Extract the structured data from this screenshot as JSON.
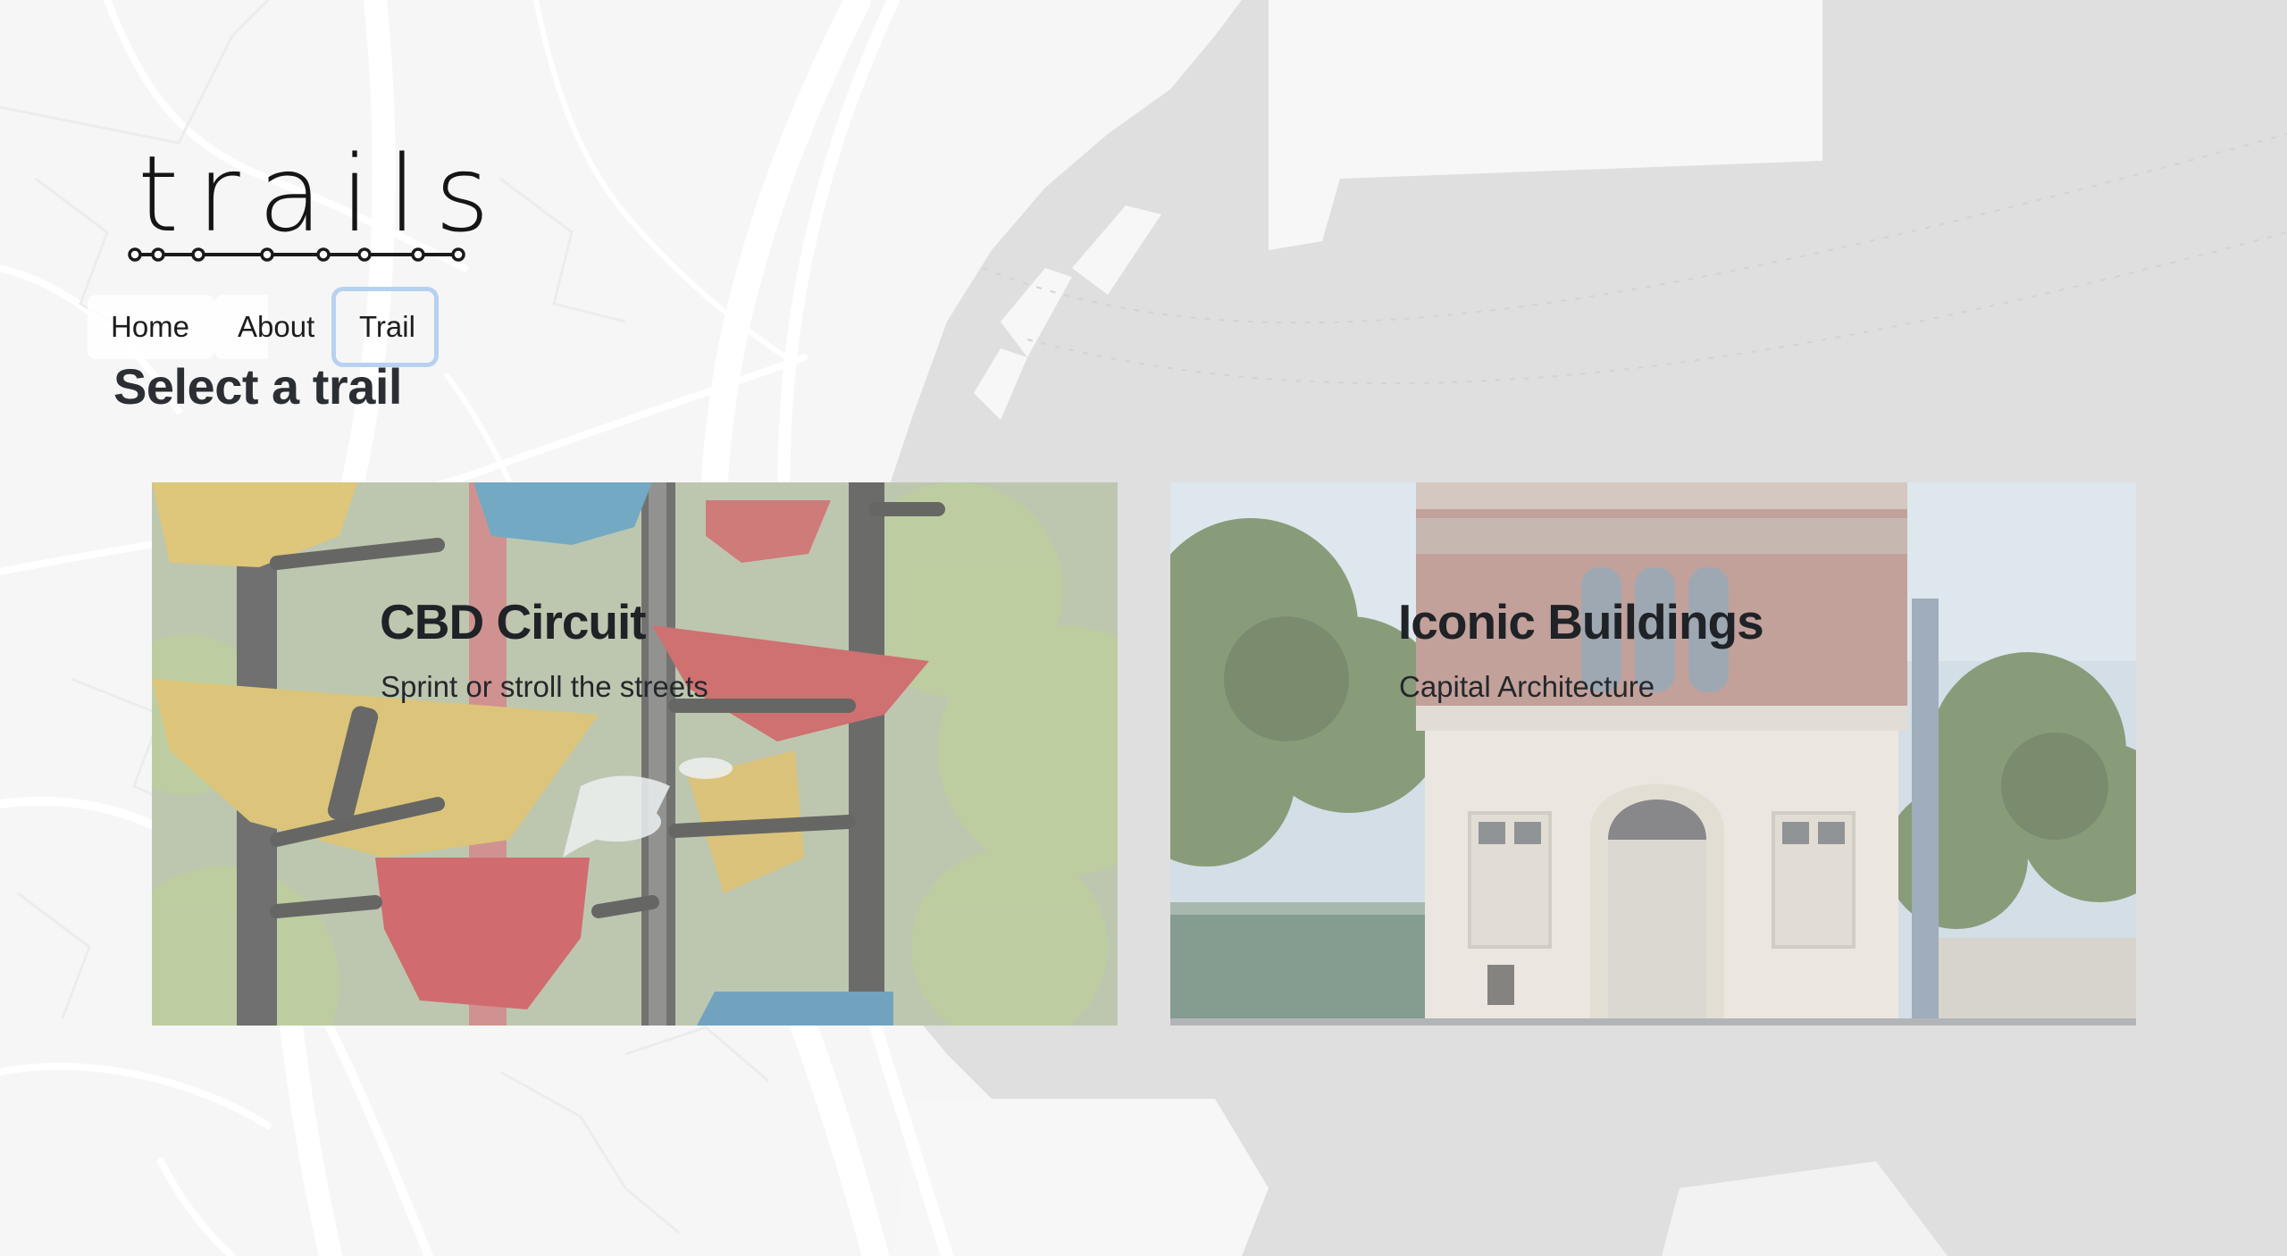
{
  "logo": {
    "text": "trails"
  },
  "nav": {
    "home": "Home",
    "about": "About",
    "trail": "Trail"
  },
  "page_title": "Select a trail",
  "cards": [
    {
      "title": "CBD Circuit",
      "subtitle": "Sprint or stroll the streets"
    },
    {
      "title": "Iconic Buildings",
      "subtitle": "Capital Architecture"
    }
  ],
  "colors": {
    "nav_focus_ring": "#b7d2f0",
    "map_sea": "#dedede",
    "map_land": "#f7f7f7"
  }
}
